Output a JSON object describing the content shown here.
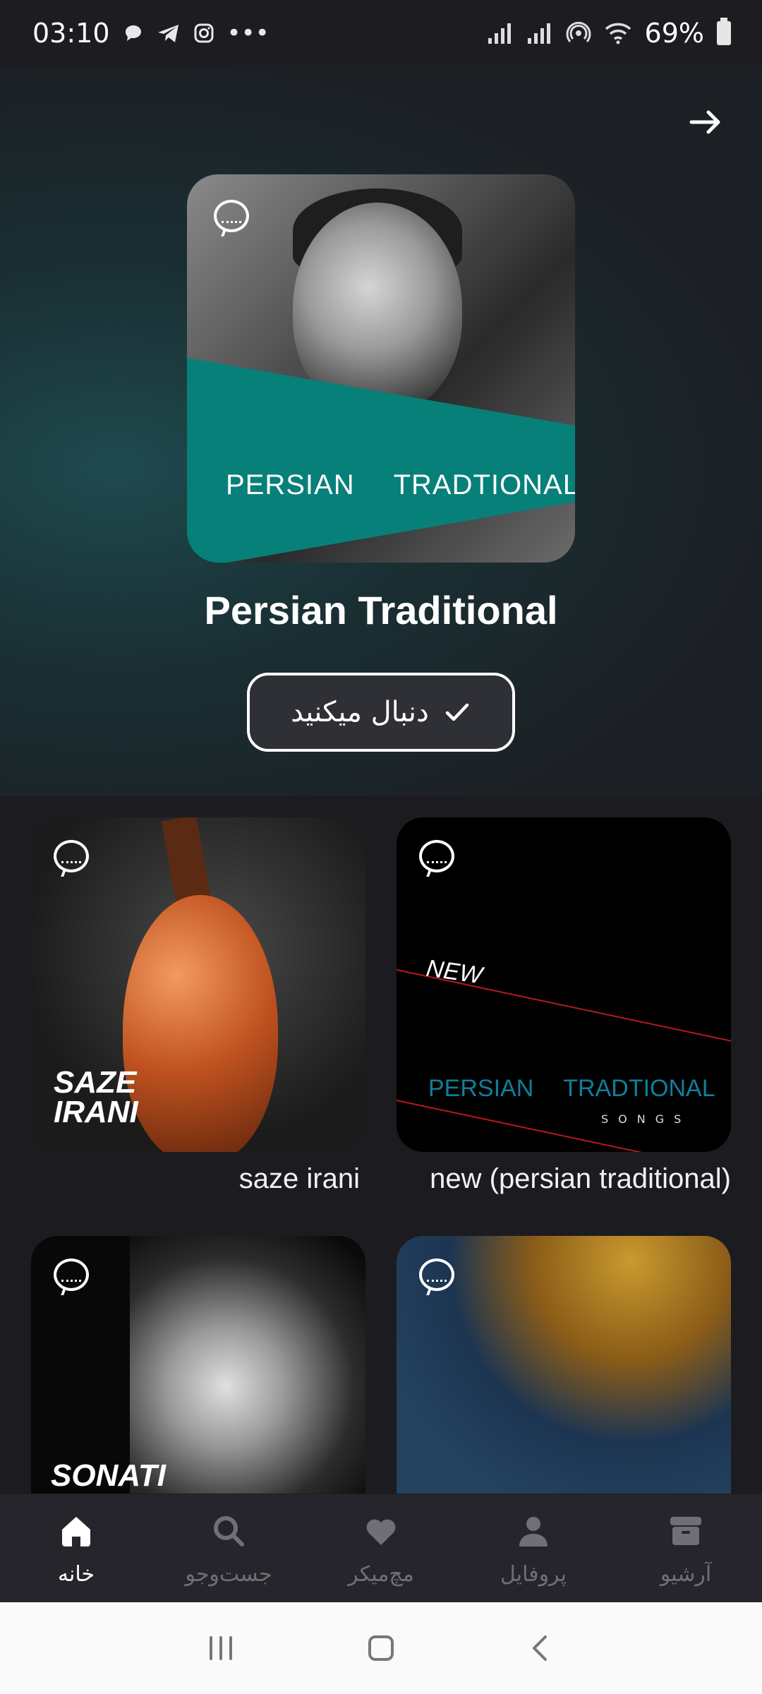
{
  "status_bar": {
    "time": "03:10",
    "notification_icons": [
      "chat-bubble-icon",
      "telegram-icon",
      "instagram-icon",
      "more-dots-icon"
    ],
    "more": "•••",
    "battery": "69%"
  },
  "header": {
    "title": "Persian Traditional",
    "cover_text": [
      "PERSIAN",
      "TRADTIONAL"
    ],
    "follow_button": "دنبال میکنید"
  },
  "playlists": [
    {
      "label": "saze irani",
      "cover_text": [
        "SAZE",
        "IRANI"
      ]
    },
    {
      "label": "new (persian traditional)",
      "cover_text": [
        "NEW",
        "PERSIAN",
        "TRADTIONAL",
        "SONGS"
      ]
    },
    {
      "label": "",
      "cover_text": [
        "SONATI"
      ]
    },
    {
      "label": ""
    }
  ],
  "bottom_nav": [
    {
      "label": "خانه",
      "icon": "home-icon",
      "active": true
    },
    {
      "label": "جست‌وجو",
      "icon": "search-icon",
      "active": false
    },
    {
      "label": "مچ‌میکر",
      "icon": "heart-icon",
      "active": false
    },
    {
      "label": "پروفایل",
      "icon": "user-icon",
      "active": false
    },
    {
      "label": "آرشیو",
      "icon": "archive-icon",
      "active": false
    }
  ],
  "colors": {
    "accent": "#07807a",
    "background": "#1c1c20",
    "nav_bg": "#25252b"
  }
}
